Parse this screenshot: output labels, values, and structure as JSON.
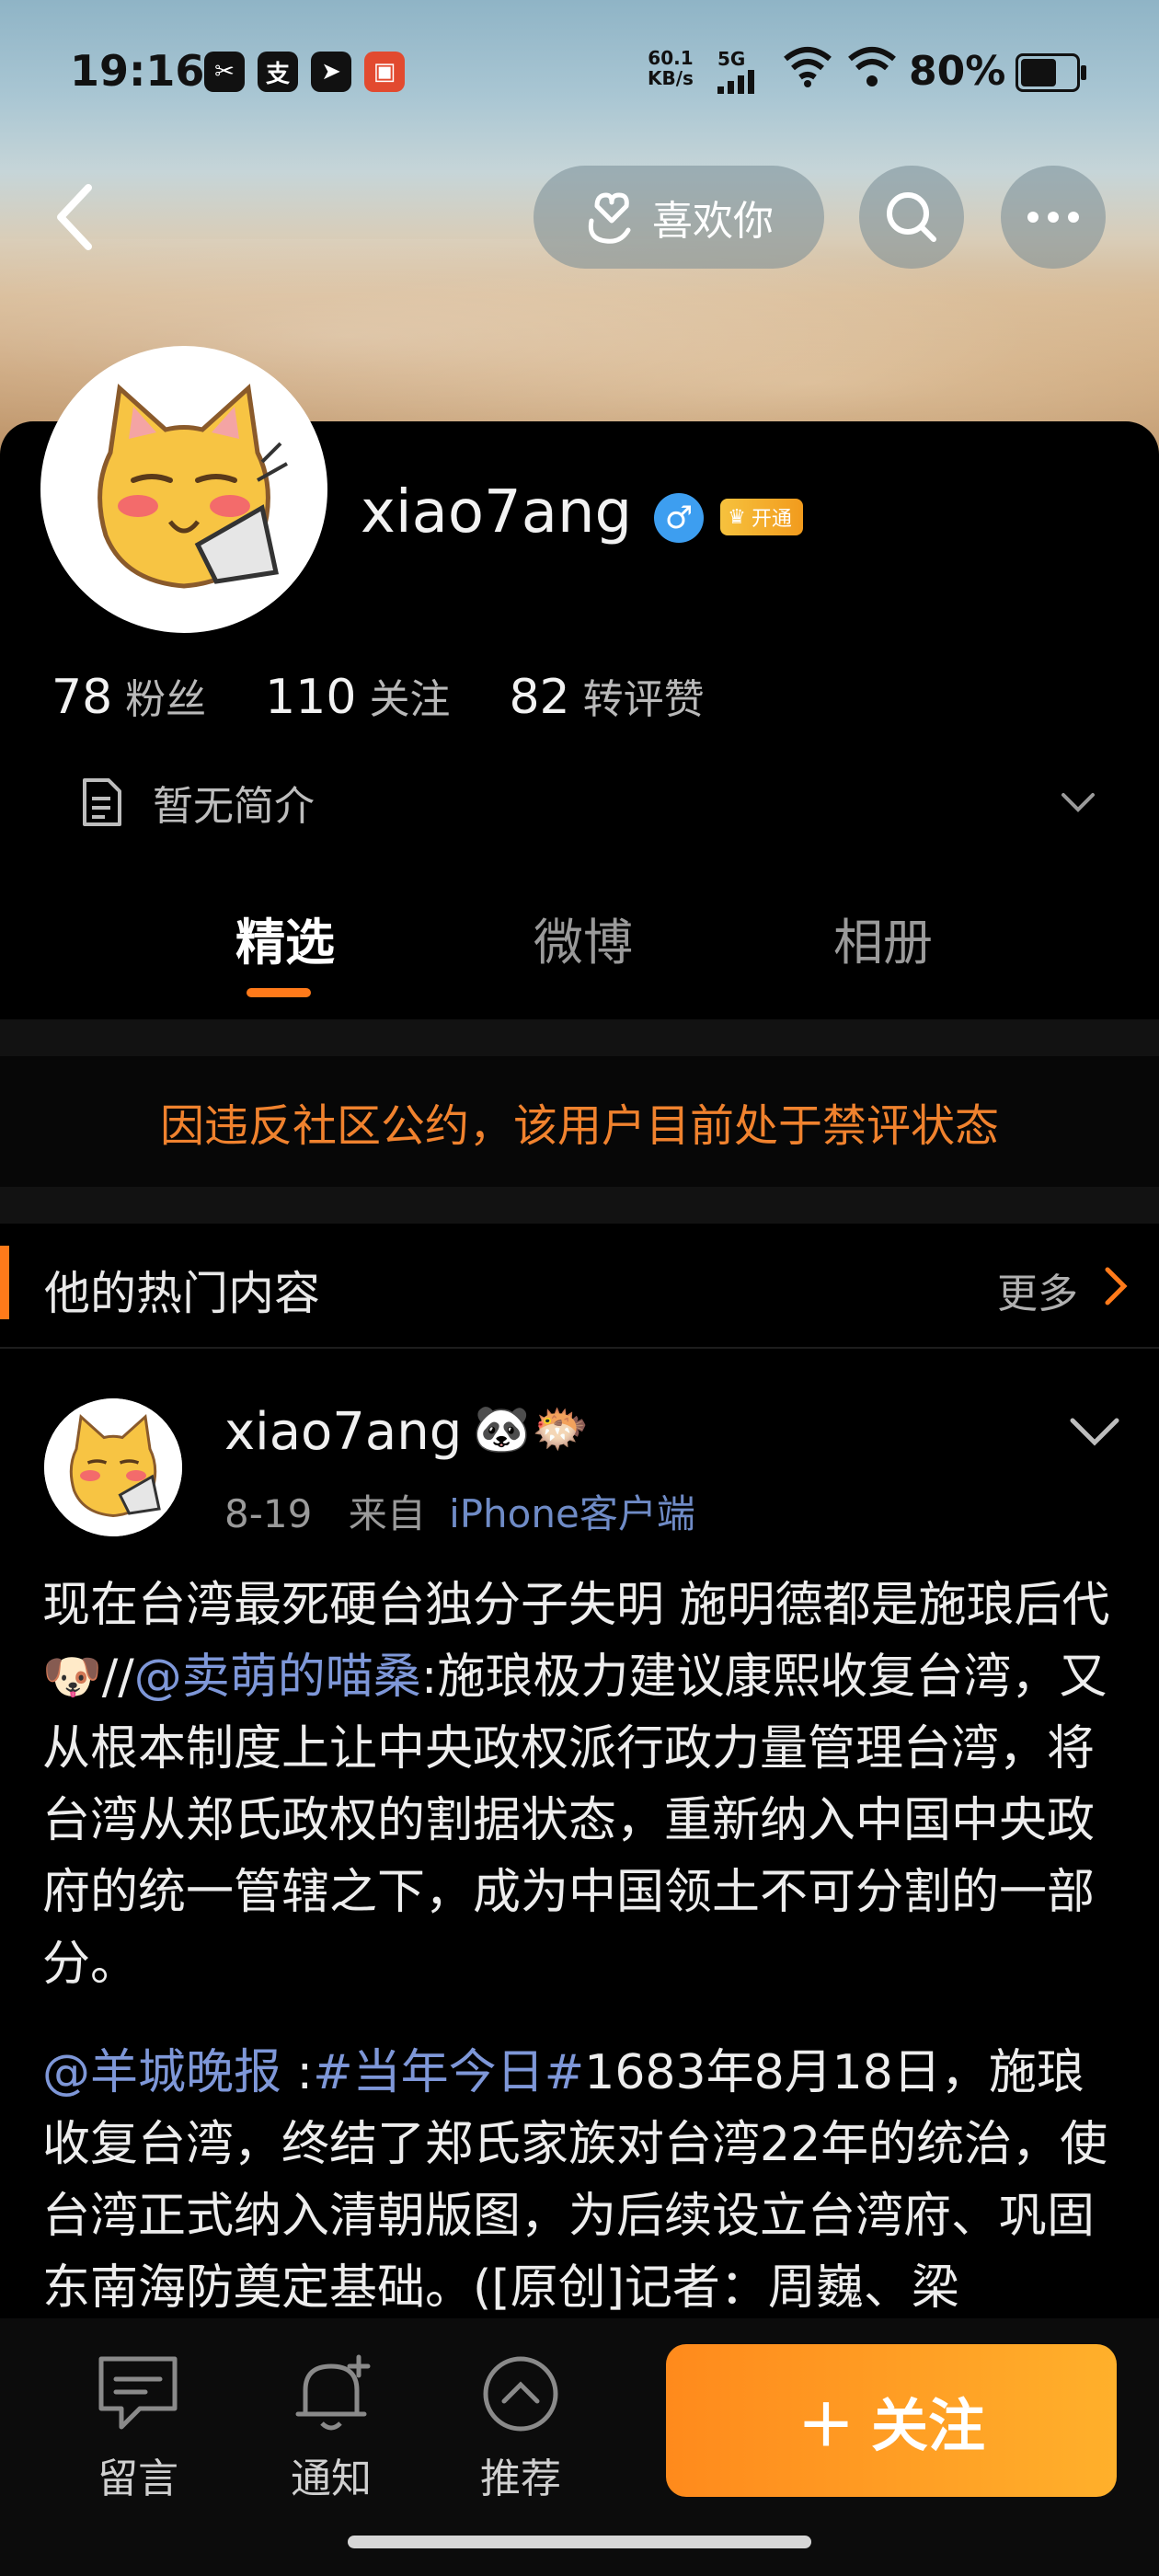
{
  "status_bar": {
    "time": "19:16",
    "net_speed_value": "60.1",
    "net_speed_unit": "KB/s",
    "network_type": "5G",
    "battery": "80%"
  },
  "nav": {
    "like_label": "喜欢你"
  },
  "profile": {
    "username": "xiao7ang",
    "gender_symbol": "♂",
    "vip_label": "开通",
    "stats": [
      {
        "value": "78",
        "label": "粉丝"
      },
      {
        "value": "110",
        "label": "关注"
      },
      {
        "value": "82",
        "label": "转评赞"
      }
    ],
    "bio": "暂无简介"
  },
  "tabs": [
    "精选",
    "微博",
    "相册"
  ],
  "notice": "因违反社区公约，该用户目前处于禁评状态",
  "hot_section": {
    "title": "他的热门内容",
    "more": "更多"
  },
  "post": {
    "username": "xiao7ang",
    "date": "8-19",
    "source_prefix": "来自",
    "source": "iPhone客户端",
    "para1_a": "现在台湾最死硬台独分子失明 施明德都是施琅后代",
    "para1_b": "//",
    "para1_mention": "@卖萌的喵桑",
    "para1_c": ":施琅极力建议康熙收复台湾，又从根本制度上让中央政权派行政力量管理台湾，将台湾从郑氏政权的割据状态，重新纳入中国中央政府的统一管辖之下，成为中国领土不可分割的一部分。",
    "para2_mention": "@羊城晚报",
    "para2_sep": " :",
    "para2_tag": "#当年今日#",
    "para2_text": "1683年8月18日，施琅收复台湾，终结了郑氏家族对台湾22年的统治，使台湾正式纳入清朝版图，为后续设立台湾府、巩固东南海防奠定基础。([原创]记者：周巍、梁"
  },
  "bottom_bar": {
    "comment": "留言",
    "notify": "通知",
    "recommend": "推荐",
    "follow": "关注"
  },
  "colors": {
    "accent": "#ff7a1a",
    "notice": "#f0822e",
    "link": "#7e97d8"
  }
}
